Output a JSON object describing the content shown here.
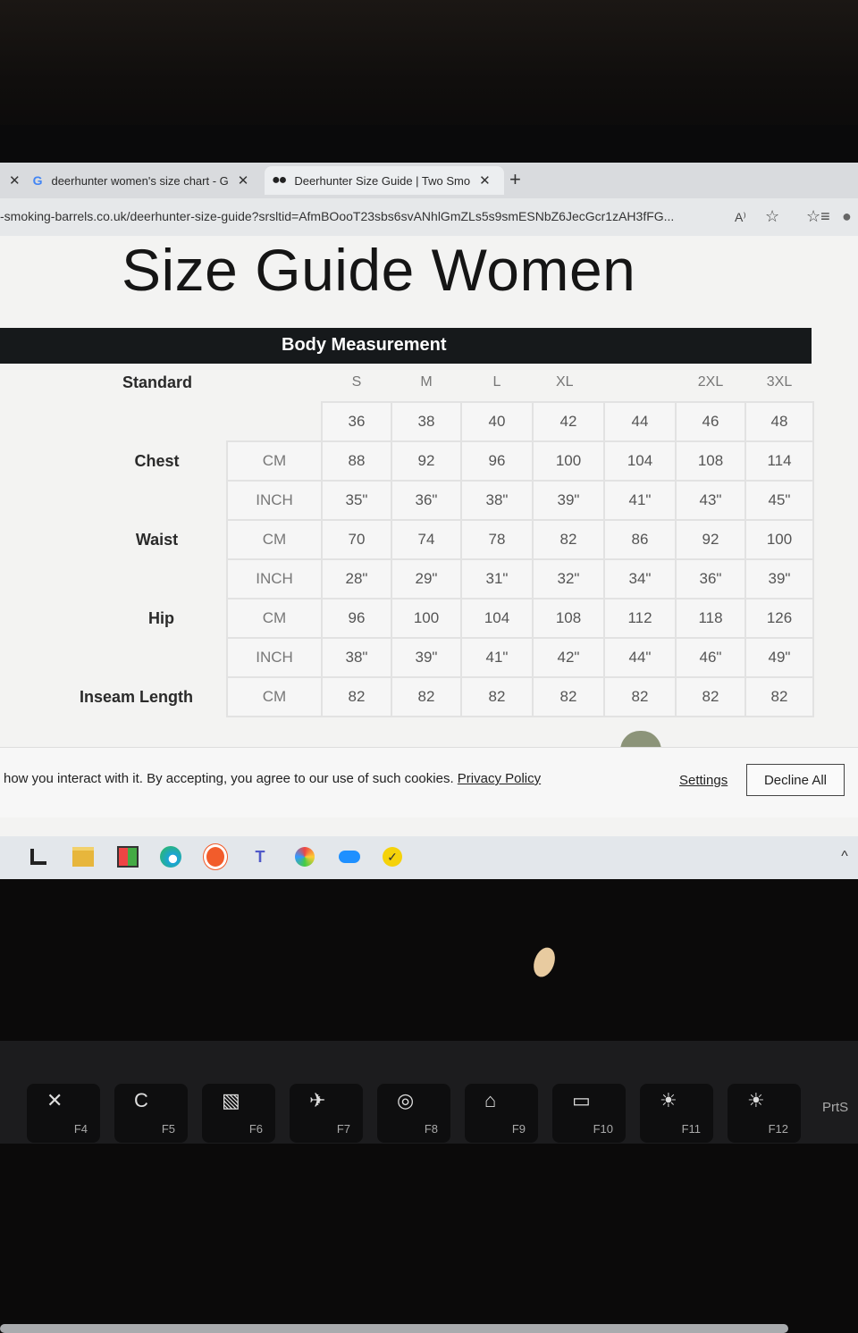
{
  "browser": {
    "tabs": [
      {
        "label": "deerhunter women's size chart - G",
        "icon": "google-logo"
      },
      {
        "label": "Deerhunter Size Guide | Two Smo",
        "icon": "two-dots-favicon"
      }
    ],
    "new_tab": "+",
    "url": "-smoking-barrels.co.uk/deerhunter-size-guide?srsltid=AfmBOooT23sbs6svANhlGmZLs5s9smESNbZ6JecGcr1zAH3fFG...",
    "read_aloud": "A⁾",
    "favorite": "☆",
    "favorites_list": "☆≡",
    "profile": "●"
  },
  "page": {
    "title": "Size Guide Women",
    "section_label": "Body Measurement",
    "standard_label": "Standard",
    "sizes": [
      "S",
      "M",
      "L",
      "XL",
      "2XL",
      "3XL"
    ],
    "size_numbers": [
      "36",
      "38",
      "40",
      "42",
      "44",
      "46",
      "48"
    ],
    "rows": [
      {
        "label": "Chest",
        "unit": "CM",
        "values": [
          "88",
          "92",
          "96",
          "100",
          "104",
          "108",
          "114"
        ]
      },
      {
        "label": "",
        "unit": "INCH",
        "values": [
          "35\"",
          "36\"",
          "38\"",
          "39\"",
          "41\"",
          "43\"",
          "45\""
        ]
      },
      {
        "label": "Waist",
        "unit": "CM",
        "values": [
          "70",
          "74",
          "78",
          "82",
          "86",
          "92",
          "100"
        ]
      },
      {
        "label": "",
        "unit": "INCH",
        "values": [
          "28\"",
          "29\"",
          "31\"",
          "32\"",
          "34\"",
          "36\"",
          "39\""
        ]
      },
      {
        "label": "Hip",
        "unit": "CM",
        "values": [
          "96",
          "100",
          "104",
          "108",
          "112",
          "118",
          "126"
        ]
      },
      {
        "label": "",
        "unit": "INCH",
        "values": [
          "38\"",
          "39\"",
          "41\"",
          "42\"",
          "44\"",
          "46\"",
          "49\""
        ]
      },
      {
        "label": "Inseam Length",
        "unit": "CM",
        "values": [
          "82",
          "82",
          "82",
          "82",
          "82",
          "82",
          "82"
        ]
      }
    ]
  },
  "cookie": {
    "text": "how you interact with it. By accepting, you agree to our use of such cookies.",
    "privacy_link": "Privacy Policy",
    "settings": "Settings",
    "decline": "Decline All"
  },
  "taskbar": {
    "icons": [
      "task-view-icon",
      "file-explorer-icon",
      "store-icon",
      "edge-icon",
      "brave-icon",
      "teams-icon",
      "paint-icon",
      "onedrive-icon",
      "checklist-icon"
    ],
    "chevron": "^"
  },
  "keyboard": {
    "keys": [
      {
        "glyph": "✕",
        "label": "F4"
      },
      {
        "glyph": "C",
        "label": "F5"
      },
      {
        "glyph": "▧",
        "label": "F6"
      },
      {
        "glyph": "✈",
        "label": "F7"
      },
      {
        "glyph": "◎",
        "label": "F8"
      },
      {
        "glyph": "⌂",
        "label": "F9"
      },
      {
        "glyph": "▭",
        "label": "F10"
      },
      {
        "glyph": "☀",
        "label": "F11"
      },
      {
        "glyph": "☀",
        "label": "F12"
      }
    ],
    "prtsc": "PrtS"
  }
}
